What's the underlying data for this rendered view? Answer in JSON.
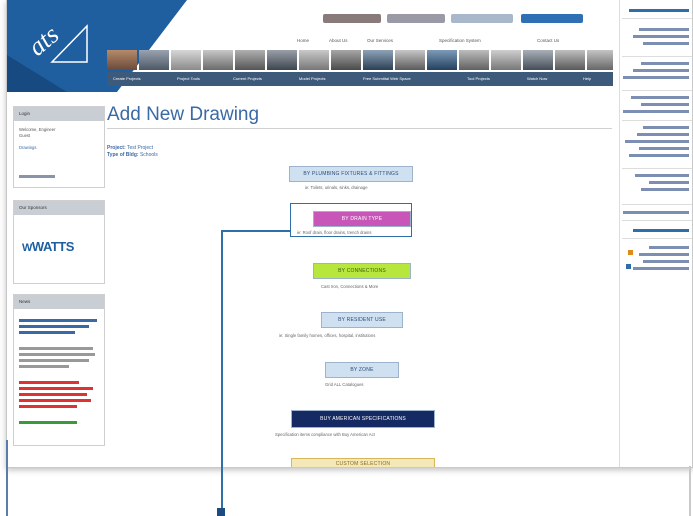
{
  "logo": {
    "text": "ats"
  },
  "top_nav": {
    "links": [
      "Home",
      "About Us",
      "Our Services",
      "Specification System",
      "Contact Us"
    ]
  },
  "main_nav": {
    "items": [
      "Create Projects",
      "Project Tools",
      "Current Projects",
      "Model Projects",
      "Free Submittal Web Space",
      "Tool Projects",
      "Watch Now",
      "Help"
    ]
  },
  "sidebar": {
    "login_heading": "Login",
    "login_lines": [
      "Welcome, Engineer",
      "Guest",
      "Drawings"
    ],
    "sponsor_heading": "Our Sponsors",
    "sponsor_logo": "WATTS",
    "news_heading": "News"
  },
  "main": {
    "title": "Add New Drawing",
    "project_label": "Project:",
    "project_value": "Test Project",
    "type_label": "Type of Bldg:",
    "type_value": "Schools",
    "options": [
      {
        "label": "BY PLUMBING FIXTURES & FITTINGS",
        "desc": "ie: Toilets, urinals, sinks, drainage",
        "bg": "#cfe0f0",
        "fg": "#2a4d7a"
      },
      {
        "label": "BY DRAIN TYPE",
        "desc": "ie: Roof drain, floor drains, trench drains",
        "bg": "#c855b8",
        "fg": "#ffffff"
      },
      {
        "label": "BY CONNECTIONS",
        "desc": "Cast Iron, Connections & More",
        "bg": "#b7e63c",
        "fg": "#3a5a10"
      },
      {
        "label": "BY RESIDENT USE",
        "desc": "ie: Single family homes, offices, hospital, institutions",
        "bg": "#cfe0f0",
        "fg": "#2a4d7a"
      },
      {
        "label": "BY ZONE",
        "desc": "Grid ALL Catalogues",
        "bg": "#cfe0f0",
        "fg": "#2a4d7a"
      },
      {
        "label": "BUY AMERICAN SPECIFICATIONS",
        "desc": "Specification items compliance with Buy American Act",
        "bg": "#152a63",
        "fg": "#ffffff"
      },
      {
        "label": "CUSTOM SELECTION",
        "desc": "",
        "bg": "#f4e7b8",
        "fg": "#8a6b1a"
      }
    ]
  },
  "colors": {
    "header_blue": "#1f5fa0",
    "nav_bar": "#3d5a7a",
    "title_blue": "#3a6aa6",
    "callout": "#2f6ea6"
  }
}
